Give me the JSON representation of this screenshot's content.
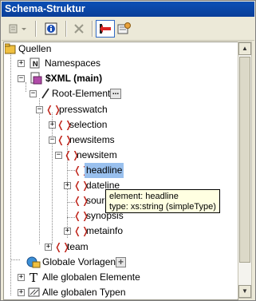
{
  "window": {
    "title": "Schema-Struktur"
  },
  "toolbar": {
    "icons": [
      "insert-menu-icon",
      "info-icon",
      "delete-icon",
      "sync-icon",
      "settings-icon"
    ]
  },
  "tree": {
    "root_label": "Quellen",
    "namespaces": "Namespaces",
    "main_source": "$XML (main)",
    "root_elements": "Root-Elemente",
    "root_more_button": "...",
    "presswatch": "presswatch",
    "selection": "selection",
    "newsitems": "newsitems",
    "newsitem": "newsitem",
    "headline": "headline",
    "dateline": "dateline",
    "source": "source",
    "synopsis": "synopsis",
    "metainfo": "metainfo",
    "team": "team",
    "global_templates": "Globale Vorlagen",
    "global_elements": "Alle globalen Elemente",
    "global_types": "Alle globalen Typen"
  },
  "tooltip": {
    "line1": "element: headline",
    "line2": "type: xs:string (simpleType)"
  }
}
